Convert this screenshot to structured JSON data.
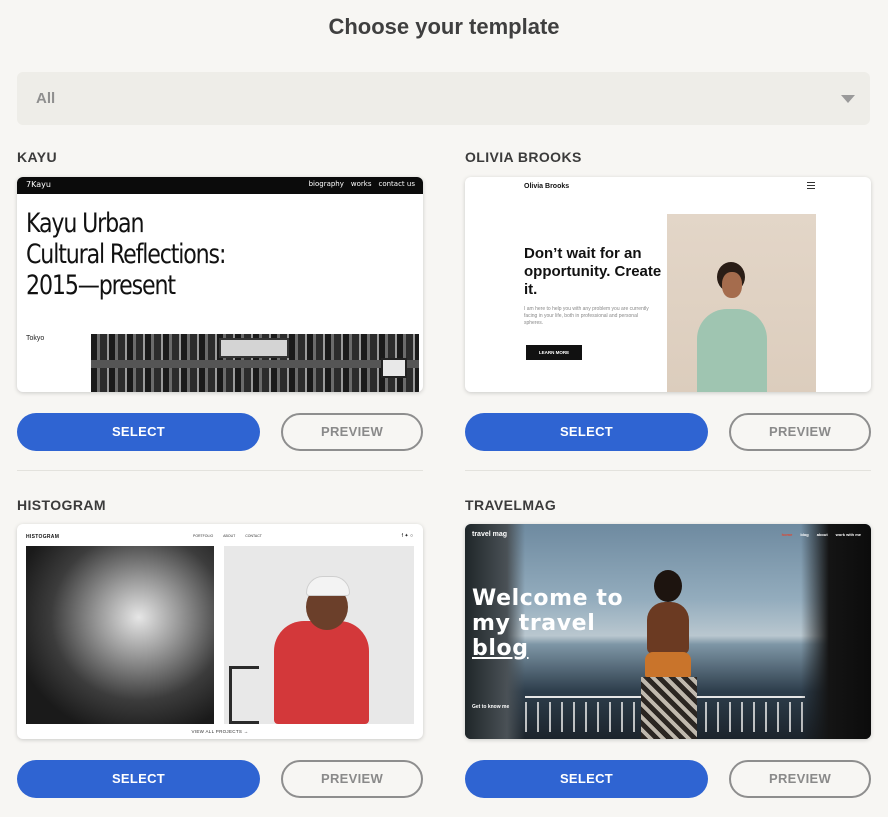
{
  "page": {
    "title": "Choose your template"
  },
  "filter": {
    "value": "All"
  },
  "buttons": {
    "select": "SELECT",
    "preview": "PREVIEW"
  },
  "templates": [
    {
      "name": "KAYU",
      "preview": {
        "logo": "7Kayu",
        "nav": [
          "biography",
          "works",
          "contact us"
        ],
        "headline": "Kayu Urban\nCultural Reflections:\n2015—present",
        "city": "Tokyo"
      }
    },
    {
      "name": "OLIVIA BROOKS",
      "preview": {
        "brand": "Olivia Brooks",
        "headline": "Don’t wait for an opportunity. Create it.",
        "body": "I am here to help you with any problem you are currently facing in your life, both in professional and personal spheres.",
        "cta": "LEARN MORE"
      }
    },
    {
      "name": "HISTOGRAM",
      "preview": {
        "brand": "HISTOGRAM",
        "nav": [
          "PORTFOLIO",
          "ABOUT",
          "CONTACT"
        ],
        "social": "f  ✦  ○",
        "link": "VIEW ALL PROJECTS →"
      }
    },
    {
      "name": "TRAVELMAG",
      "preview": {
        "logo": "travel mag",
        "nav": [
          "home",
          "blog",
          "about",
          "work with me"
        ],
        "headline_1": "Welcome to",
        "headline_2": "my travel",
        "headline_3": "blog",
        "cta": "Get to know me"
      }
    }
  ],
  "colors": {
    "accent": "#2f64d2",
    "background": "#f7f6f3",
    "filter_bg": "#eeede8"
  },
  "icons": {
    "dropdown": "chevron-down-icon"
  }
}
